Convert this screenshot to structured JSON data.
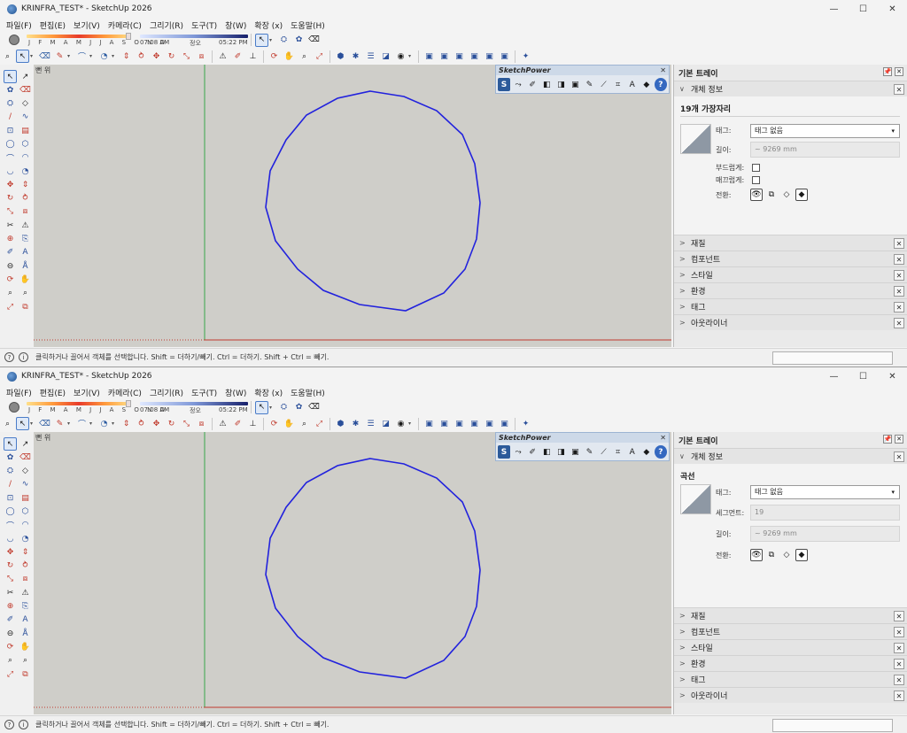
{
  "title": "KRINFRA_TEST* - SketchUp 2026",
  "window_controls": {
    "minimize": "—",
    "maximize": "☐",
    "close": "✕"
  },
  "menus": [
    "파일(F)",
    "편집(E)",
    "보기(V)",
    "카메라(C)",
    "그리기(R)",
    "도구(T)",
    "창(W)",
    "확장 (x)",
    "도움말(H)"
  ],
  "shadows": {
    "months": "J F M A M J J A S O N D",
    "time_start": "07:08 AM",
    "time_mid": "정오",
    "time_end": "05:22 PM"
  },
  "scene_label": "뻔 위",
  "sketchpower": {
    "title": "SketchPower",
    "close": "✕",
    "s_label": "S",
    "help_label": "?"
  },
  "tray": {
    "title": "기본 트레이",
    "pin": "📌",
    "x": "✕",
    "entity_info_label": "개체 정보",
    "tag_label": "태그:",
    "tag_value": "태그 없음",
    "length_label": "길이:",
    "length_value": "~ 9269 mm",
    "toggle_label": "전환:",
    "soft_label": "부드럽게:",
    "smooth_label": "매끄럽게:",
    "segments_label": "세그먼트:",
    "segments_value": "19",
    "sections": [
      "재질",
      "컴포넌트",
      "스타일",
      "환경",
      "태그",
      "아웃라이너"
    ]
  },
  "top_panel": {
    "entity_name": "19개 가장자리"
  },
  "bottom_panel": {
    "entity_name": "곡선"
  },
  "status": {
    "text": "클릭하거나 끌어서 객체를 선택합니다. Shift = 더하기/빼기. Ctrl = 더하기. Shift + Ctrl = 빼기.",
    "help_icon": "?",
    "info_icon": "i"
  },
  "colors": {
    "curve": "#2222dd",
    "green_axis": "#3aa54a",
    "red_axis": "#c23a2e",
    "viewport": "#cfcec9"
  }
}
